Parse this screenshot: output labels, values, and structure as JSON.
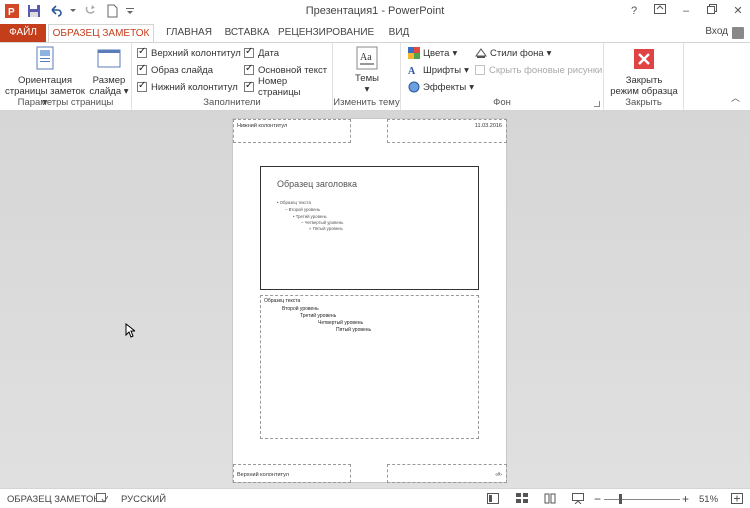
{
  "window": {
    "title": "Презентация1 - PowerPoint",
    "signin": "Вход"
  },
  "tabs": [
    "ФАЙЛ",
    "ОБРАЗЕЦ ЗАМЕТОК",
    "ГЛАВНАЯ",
    "ВСТАВКА",
    "РЕЦЕНЗИРОВАНИЕ",
    "ВИД"
  ],
  "ribbon": {
    "page_setup": {
      "orientation_line1": "Ориентация",
      "orientation_line2": "страницы заметок",
      "size_line1": "Размер",
      "size_line2": "слайда",
      "label": "Параметры страницы"
    },
    "placeholders": {
      "header": "Верхний колонтитул",
      "slide_image": "Образ слайда",
      "footer": "Нижний колонтитул",
      "date": "Дата",
      "body": "Основной текст",
      "page_number": "Номер страницы",
      "label": "Заполнители"
    },
    "edit_theme": {
      "themes": "Темы",
      "label": "Изменить тему"
    },
    "background": {
      "colors": "Цвета",
      "fonts": "Шрифты",
      "effects": "Эффекты",
      "bg_styles": "Стили фона",
      "hide_bg": "Скрыть фоновые рисунки",
      "label": "Фон"
    },
    "close": {
      "line1": "Закрыть",
      "line2": "режим образца",
      "label": "Закрыть"
    }
  },
  "notes_page": {
    "header": "Нижний колонтитул",
    "date": "11.03.2016",
    "footer": "Верхний колонтитул",
    "page_number": "‹#›",
    "slide": {
      "title": "Образец заголовка",
      "levels": [
        "Образец текста",
        "Второй уровень",
        "Третий уровень",
        "Четвертый уровень",
        "Пятый уровень"
      ]
    },
    "notes_levels": [
      "Образец текста",
      "Второй уровень",
      "Третий уровень",
      "Четвертый уровень",
      "Пятый уровень"
    ]
  },
  "status": {
    "view": "ОБРАЗЕЦ ЗАМЕТОК",
    "language": "РУССКИЙ",
    "zoom": "51%"
  },
  "colors": {
    "accent": "#c43e1c",
    "close_red": "#e04343"
  }
}
